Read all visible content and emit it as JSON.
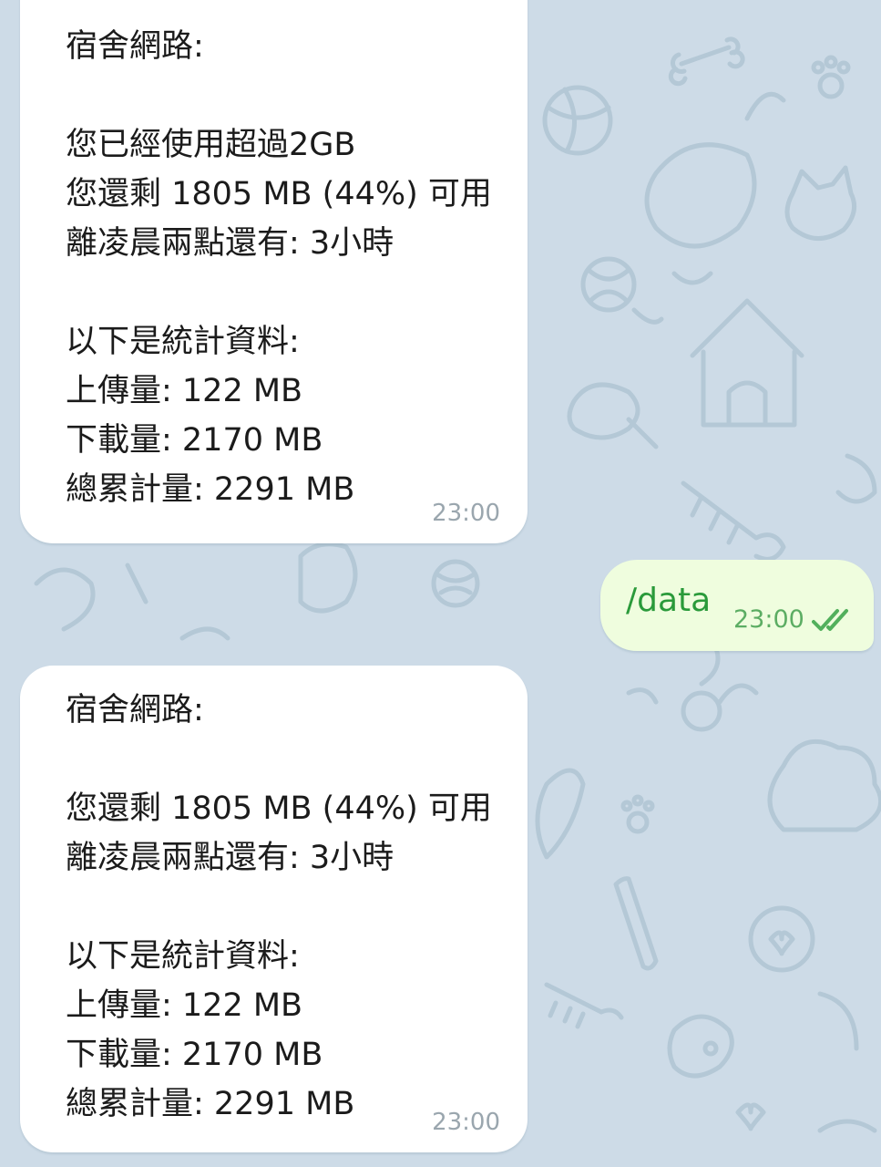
{
  "messages": [
    {
      "direction": "incoming",
      "lines": {
        "l1": "宿舍網路:",
        "l2": "您已經使用超過2GB",
        "l3": "您還剩 1805 MB (44%) 可用",
        "l4": "離凌晨兩點還有: 3小時",
        "l5": "以下是統計資料:",
        "l6": "上傳量: 122 MB",
        "l7": "下載量: 2170 MB",
        "l8": "總累計量: 2291 MB"
      },
      "time": "23:00"
    },
    {
      "direction": "outgoing",
      "text": "/data",
      "time": "23:00",
      "status": "read",
      "status_icon": "double-check-icon"
    },
    {
      "direction": "incoming",
      "lines": {
        "l1": "宿舍網路:",
        "l2": "您還剩 1805 MB (44%) 可用",
        "l3": "離凌晨兩點還有: 3小時",
        "l4": "以下是統計資料:",
        "l5": "上傳量: 122 MB",
        "l6": "下載量: 2170 MB",
        "l7": "總累計量: 2291 MB"
      },
      "time": "23:00"
    }
  ],
  "colors": {
    "background": "#cddbe7",
    "incoming_bubble": "#ffffff",
    "outgoing_bubble": "#effdde",
    "outgoing_text": "#2a9a3a",
    "read_check": "#52b05c"
  }
}
